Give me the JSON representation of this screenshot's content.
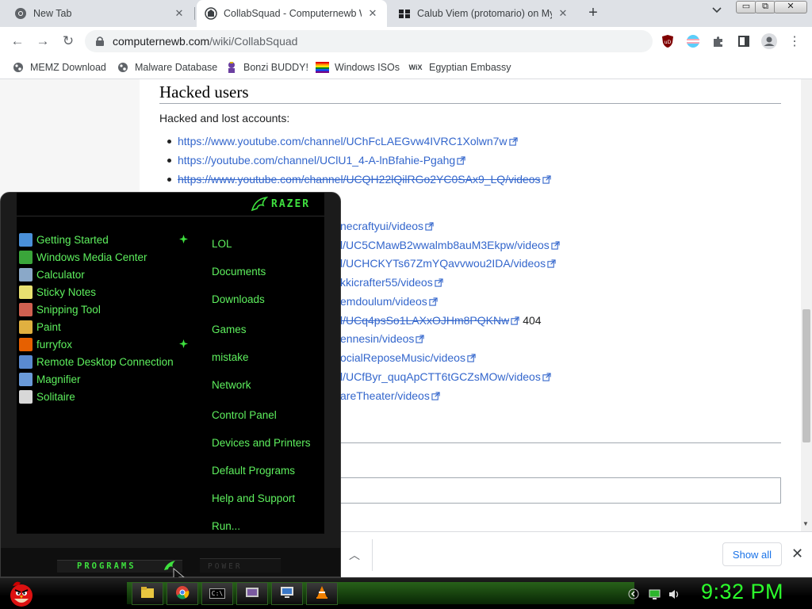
{
  "browser": {
    "tabs": [
      {
        "title": "New Tab",
        "icon": "chrome-icon",
        "active": false
      },
      {
        "title": "CollabSquad - Computernewb W",
        "icon": "wiki-icon",
        "active": true
      },
      {
        "title": "Calub Viem (protomario) on Mys",
        "icon": "users-icon",
        "active": false
      }
    ],
    "url": {
      "host": "computernewb.com",
      "path": "/wiki/CollabSquad"
    },
    "window_buttons": {
      "minimize": "▭",
      "restore": "⧉",
      "close": "✕"
    },
    "bookmarks": [
      {
        "label": "MEMZ Download",
        "icon": "globe-icon"
      },
      {
        "label": "Malware Database",
        "icon": "globe-icon"
      },
      {
        "label": "Bonzi BUDDY!",
        "icon": "bonzi-icon"
      },
      {
        "label": "Windows ISOs",
        "icon": "rainbow-flag-icon"
      },
      {
        "label": "Egyptian Embassy",
        "icon": "wix-icon",
        "icon_text": "WiX"
      }
    ]
  },
  "article": {
    "heading": "Hacked users",
    "intro": "Hacked and lost accounts:",
    "links": [
      {
        "text": "https://www.youtube.com/channel/UChFcLAEGvw4IVRC1Xolwn7w",
        "struck": false
      },
      {
        "text": "https://youtube.com/channel/UClU1_4-A-lnBfahie-Pgahg",
        "struck": false
      },
      {
        "text": "https://www.youtube.com/channel/UCQH22lQilRGo2YC0SAx9_LQ/videos",
        "struck": true
      },
      {
        "text": "necraftyui/videos",
        "struck": false
      },
      {
        "text": "l/UC5CMawB2wwalmb8auM3Ekpw/videos",
        "struck": false
      },
      {
        "text": "l/UCHCKYTs67ZmYQavvwou2IDA/videos",
        "struck": false
      },
      {
        "text": "kkicrafter55/videos",
        "struck": false
      },
      {
        "text": "emdoulum/videos",
        "struck": false
      },
      {
        "text": "l/UCq4psSo1LAXxOJHm8PQKNw",
        "struck": true,
        "suffix": "404"
      },
      {
        "text": "ennesin/videos",
        "struck": false
      },
      {
        "text": "ocialReposeMusic/videos",
        "struck": false
      },
      {
        "text": "l/UCfByr_quqApCTT6tGCZsMOw/videos",
        "struck": false
      },
      {
        "text": "areTheater/videos",
        "struck": false
      }
    ]
  },
  "download_bar": {
    "show_all": "Show all",
    "close": "✕",
    "chevron": "︿"
  },
  "start_menu": {
    "brand": "RAZER",
    "programs": [
      {
        "label": "Getting Started",
        "icon": "getting-started-icon",
        "color": "#4a90d9",
        "new": true
      },
      {
        "label": "Windows Media Center",
        "icon": "media-center-icon",
        "color": "#3aa53a",
        "new": false
      },
      {
        "label": "Calculator",
        "icon": "calculator-icon",
        "color": "#8aa8c8",
        "new": false
      },
      {
        "label": "Sticky Notes",
        "icon": "sticky-notes-icon",
        "color": "#e8e070",
        "new": false
      },
      {
        "label": "Snipping Tool",
        "icon": "snipping-tool-icon",
        "color": "#d06050",
        "new": false
      },
      {
        "label": "Paint",
        "icon": "paint-icon",
        "color": "#e0b040",
        "new": false
      },
      {
        "label": "furryfox",
        "icon": "firefox-icon",
        "color": "#e66000",
        "new": true
      },
      {
        "label": "Remote Desktop Connection",
        "icon": "remote-desktop-icon",
        "color": "#5a8ad0",
        "new": false
      },
      {
        "label": "Magnifier",
        "icon": "magnifier-icon",
        "color": "#6a9ad8",
        "new": false
      },
      {
        "label": "Solitaire",
        "icon": "solitaire-icon",
        "color": "#d8d8d8",
        "new": false
      }
    ],
    "places": [
      "LOL",
      "Documents",
      "Downloads",
      "Games",
      "mistake",
      "Network",
      "Control Panel",
      "Devices and Printers",
      "Default Programs",
      "Help and Support",
      "Run..."
    ],
    "programs_label": "PROGRAMS",
    "power_label": "POWER"
  },
  "taskbar": {
    "clock": "9:32 PM",
    "apps": [
      {
        "name": "explorer-icon"
      },
      {
        "name": "chrome-icon"
      },
      {
        "name": "cmd-icon",
        "text": "C:\\"
      },
      {
        "name": "media-player-icon"
      },
      {
        "name": "remote-desktop-icon"
      },
      {
        "name": "vlc-icon"
      }
    ],
    "tray": [
      "show-hidden-icon",
      "network-icon",
      "volume-icon"
    ]
  },
  "colors": {
    "link": "#3366cc",
    "razer_green": "#5ef05e",
    "clock": "#2cff2c"
  }
}
